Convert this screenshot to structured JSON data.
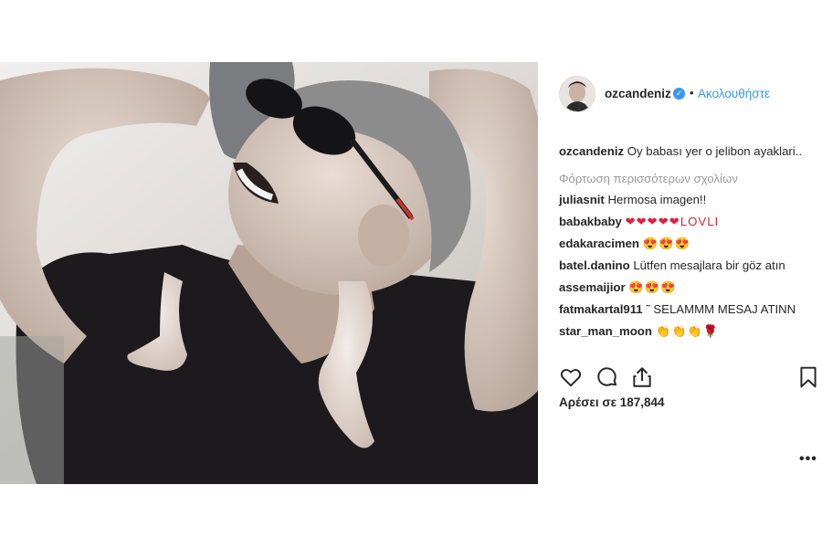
{
  "post": {
    "username": "ozcandeniz",
    "separator": "•",
    "follow_label": "Ακολουθήστε",
    "verified_glyph": "✓",
    "caption": "Oy babası yer o jelibon ayaklari..",
    "load_more": "Φόρτωση περισσότερων σχολίων",
    "likes_text": "Αρέσει σε 187,844",
    "more_label": "•••"
  },
  "comments": [
    {
      "user": "juliasnit",
      "text": "Hermosa imagen!!"
    },
    {
      "user": "babakbaby",
      "text": "❤❤❤❤❤LOVLI"
    },
    {
      "user": "edakaracimen",
      "text": "😍😍😍"
    },
    {
      "user": "batel.danino",
      "text": "Lütfen mesajlara bir göz atın"
    },
    {
      "user": "assemaijior",
      "text": "😍😍😍"
    },
    {
      "user": "fatmakartal911",
      "text": "˜ SELAMMM MESAJ ATINN"
    },
    {
      "user": "star_man_moon",
      "text": "👏👏👏🌹"
    }
  ],
  "icons": {
    "like": "heart-icon",
    "comment": "comment-icon",
    "share": "share-icon",
    "save": "bookmark-icon",
    "verified": "verified-badge-icon",
    "more": "more-options-icon"
  },
  "colors": {
    "link": "#3897f0",
    "text": "#262626",
    "muted": "#999999",
    "heart": "#e0213a"
  }
}
